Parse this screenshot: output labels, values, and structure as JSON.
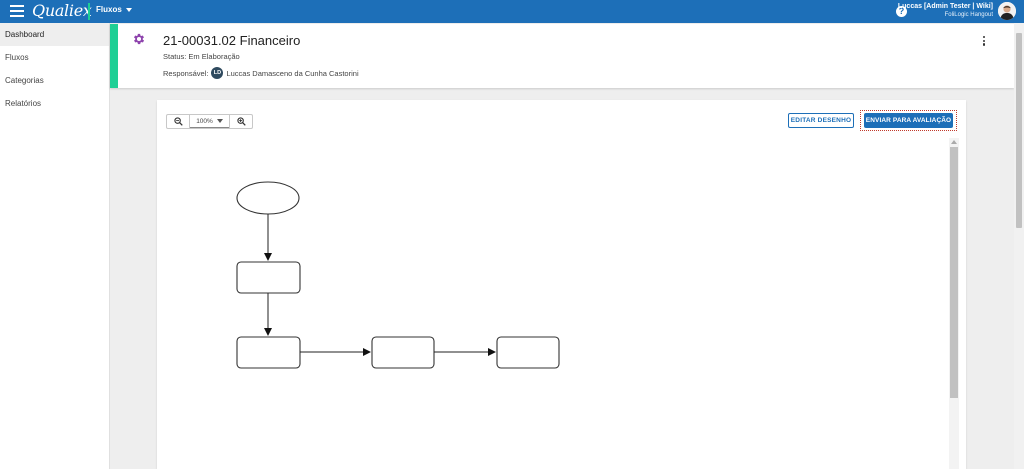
{
  "app": {
    "logo": "Qualiex",
    "module": "Fluxos"
  },
  "user": {
    "name": "Luccas [Admin Tester | Wiki]",
    "org": "FoliLogic Hangout"
  },
  "sidebar": {
    "items": [
      {
        "label": "Dashboard",
        "active": true
      },
      {
        "label": "Fluxos",
        "active": false
      },
      {
        "label": "Categorias",
        "active": false
      },
      {
        "label": "Relatórios",
        "active": false
      }
    ]
  },
  "header": {
    "title": "21-00031.02 Financeiro",
    "status": "Status: Em Elaboração",
    "responsible_label": "Responsável:",
    "responsible_initials": "LD",
    "responsible_name": "Luccas Damasceno da Cunha Castorini"
  },
  "toolbar": {
    "zoom_value": "100%",
    "edit_button": "EDITAR DESENHO",
    "submit_button": "ENVIAR PARA AVALIAÇÃO"
  },
  "colors": {
    "primary": "#1d6fb8",
    "accent": "#1ecf95",
    "gear": "#8e44ad"
  },
  "icons": [
    "menu-icon",
    "help-icon",
    "avatar",
    "gear-icon",
    "kebab-menu-icon",
    "zoom-out-icon",
    "zoom-in-icon"
  ]
}
